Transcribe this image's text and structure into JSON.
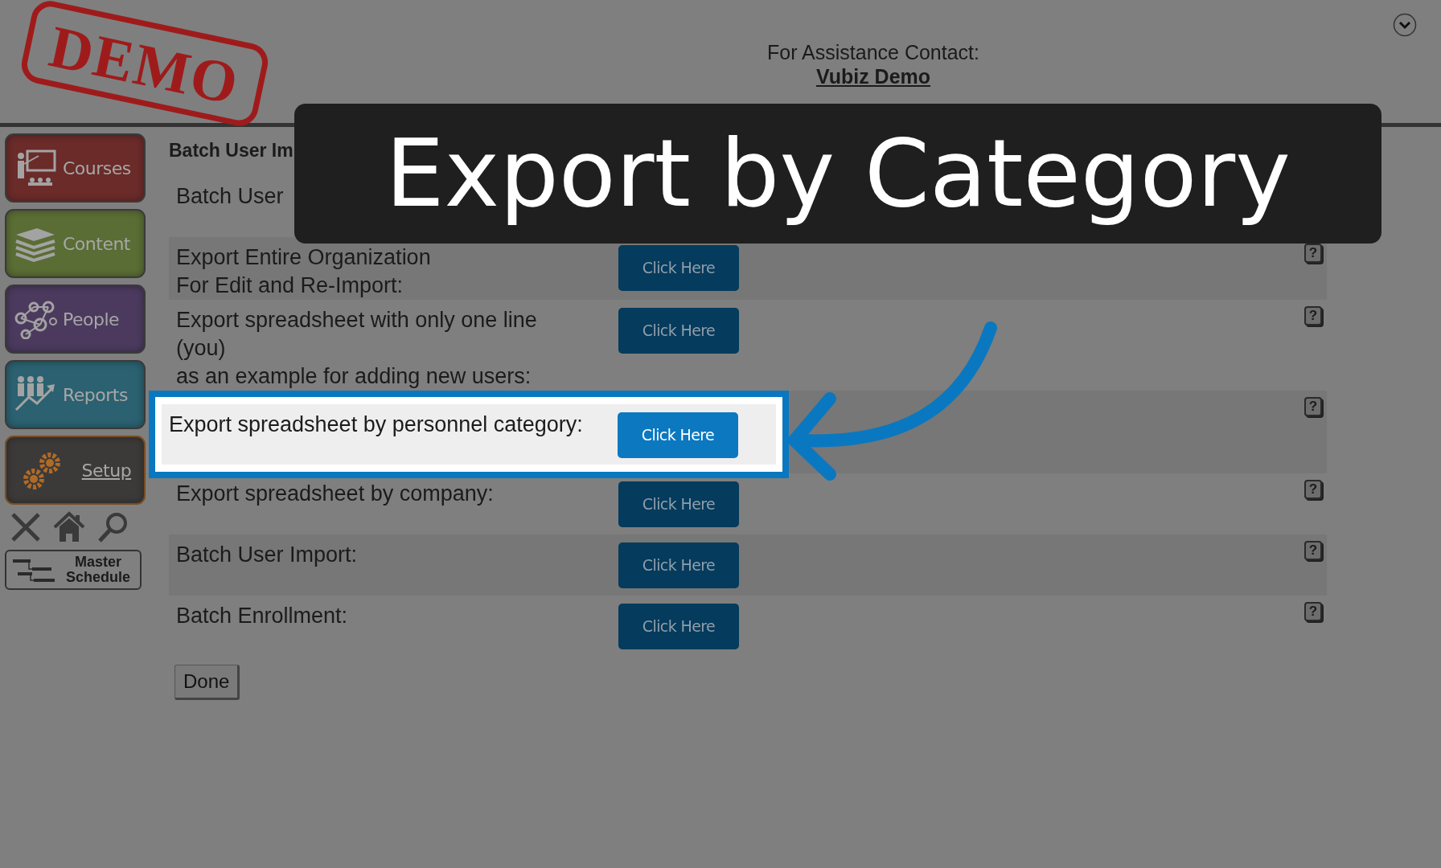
{
  "stamp": "DEMO",
  "header": {
    "assistance_label": "For Assistance Contact:",
    "contact_link": "Vubiz Demo"
  },
  "sidebar": {
    "items": [
      {
        "label": "Courses",
        "kind": "courses",
        "color": "#6a2b29",
        "selected": false
      },
      {
        "label": "Content",
        "kind": "content",
        "color": "#5a6d34",
        "selected": false
      },
      {
        "label": "People",
        "kind": "people",
        "color": "#4b3a5e",
        "selected": false
      },
      {
        "label": "Reports",
        "kind": "reports",
        "color": "#2b6170",
        "selected": false
      },
      {
        "label": "Setup",
        "kind": "setup",
        "color": "#3b3a39",
        "selected": true
      }
    ],
    "master_schedule": "Master Schedule"
  },
  "page": {
    "title": "Batch User Im",
    "rows": [
      {
        "label": "Batch User",
        "shaded": false,
        "highlighted": false
      },
      {
        "label": "Export Entire Organization\nFor Edit and Re-Import:",
        "button": "Click Here",
        "help": "?",
        "shaded": true,
        "highlighted": false
      },
      {
        "label": "Export spreadsheet with only one line\n(you)\nas an example for adding new users:",
        "button": "Click Here",
        "help": "?",
        "shaded": false,
        "highlighted": false
      },
      {
        "label": "Export spreadsheet by personnel category:",
        "button": "Click Here",
        "help": "?",
        "shaded": true,
        "highlighted": true
      },
      {
        "label": "Export spreadsheet by company:",
        "button": "Click Here",
        "help": "?",
        "shaded": false,
        "highlighted": false
      },
      {
        "label": "Batch User Import:",
        "button": "Click Here",
        "help": "?",
        "shaded": true,
        "highlighted": false
      },
      {
        "label": "Batch Enrollment:",
        "button": "Click Here",
        "help": "?",
        "shaded": false,
        "highlighted": false
      }
    ],
    "done_button": "Done"
  },
  "callout": {
    "caption": "Export by Category"
  }
}
